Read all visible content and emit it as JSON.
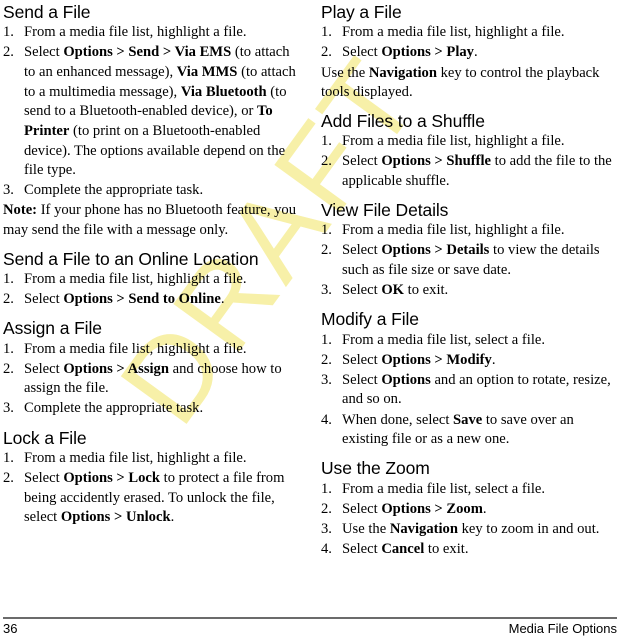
{
  "document": {
    "watermark": "DRAFT",
    "watermark_color": "#f7f0a8"
  },
  "left_column": [
    {
      "heading": "Send a File",
      "steps": [
        {
          "num": "1.",
          "html": "From a media file list, highlight a file."
        },
        {
          "num": "2.",
          "html": "Select <b>Options &gt; Send &gt; Via EMS</b> (to attach to an enhanced message), <b>Via MMS</b> (to attach to a multimedia message), <b>Via Bluetooth</b> (to send to a Bluetooth-enabled device), or <b>To Printer</b> (to print on a Bluetooth-enabled device). The options available depend on the file type."
        },
        {
          "num": "3.",
          "html": "Complete the appropriate task."
        }
      ],
      "note": "<b>Note:</b> If your phone has no Bluetooth feature, you may send the file with a message only."
    },
    {
      "heading": "Send a File to an Online Location",
      "steps": [
        {
          "num": "1.",
          "html": "From a media file list, highlight a file."
        },
        {
          "num": "2.",
          "html": "Select <b>Options &gt; Send to Online</b>."
        }
      ]
    },
    {
      "heading": "Assign a File",
      "steps": [
        {
          "num": "1.",
          "html": "From a media file list, highlight a file."
        },
        {
          "num": "2.",
          "html": "Select <b>Options &gt; Assign</b> and choose how to assign the file."
        },
        {
          "num": "3.",
          "html": "Complete the appropriate task."
        }
      ]
    },
    {
      "heading": "Lock a File",
      "steps": [
        {
          "num": "1.",
          "html": "From a media file list, highlight a file."
        },
        {
          "num": "2.",
          "html": "Select <b>Options &gt; Lock</b> to protect a file from being accidently erased. To unlock the file, select <b>Options &gt; Unlock</b>."
        }
      ]
    }
  ],
  "right_column": [
    {
      "heading": "Play a File",
      "steps": [
        {
          "num": "1.",
          "html": "From a media file list, highlight a file."
        },
        {
          "num": "2.",
          "html": "Select <b>Options &gt; Play</b>."
        }
      ],
      "note": "Use the <b>Navigation</b> key to control the playback tools displayed."
    },
    {
      "heading": "Add Files to a Shuffle",
      "steps": [
        {
          "num": "1.",
          "html": "From a media file list, highlight a file."
        },
        {
          "num": "2.",
          "html": "Select <b>Options &gt; Shuffle</b> to add the file to the applicable shuffle."
        }
      ]
    },
    {
      "heading": "View File Details",
      "steps": [
        {
          "num": "1.",
          "html": "From a media file list, highlight a file."
        },
        {
          "num": "2.",
          "html": "Select <b>Options &gt; Details</b> to view the details such as file size or save date."
        },
        {
          "num": "3.",
          "html": "Select <b>OK</b> to exit."
        }
      ]
    },
    {
      "heading": "Modify a File",
      "steps": [
        {
          "num": "1.",
          "html": "From a media file list, select a file."
        },
        {
          "num": "2.",
          "html": "Select <b>Options &gt; Modify</b>."
        },
        {
          "num": "3.",
          "html": "Select <b>Options</b> and an option to rotate, resize, and so on."
        },
        {
          "num": "4.",
          "html": "When done, select <b>Save</b> to save over an existing file or as a new one."
        }
      ]
    },
    {
      "heading": "Use the Zoom",
      "steps": [
        {
          "num": "1.",
          "html": "From a media file list, select a file."
        },
        {
          "num": "2.",
          "html": "Select <b>Options &gt; Zoom</b>."
        },
        {
          "num": "3.",
          "html": "Use the <b>Navigation</b> key to zoom in and out."
        },
        {
          "num": "4.",
          "html": "Select <b>Cancel</b> to exit."
        }
      ]
    }
  ],
  "footer": {
    "page_number": "36",
    "section_title": "Media File Options"
  }
}
